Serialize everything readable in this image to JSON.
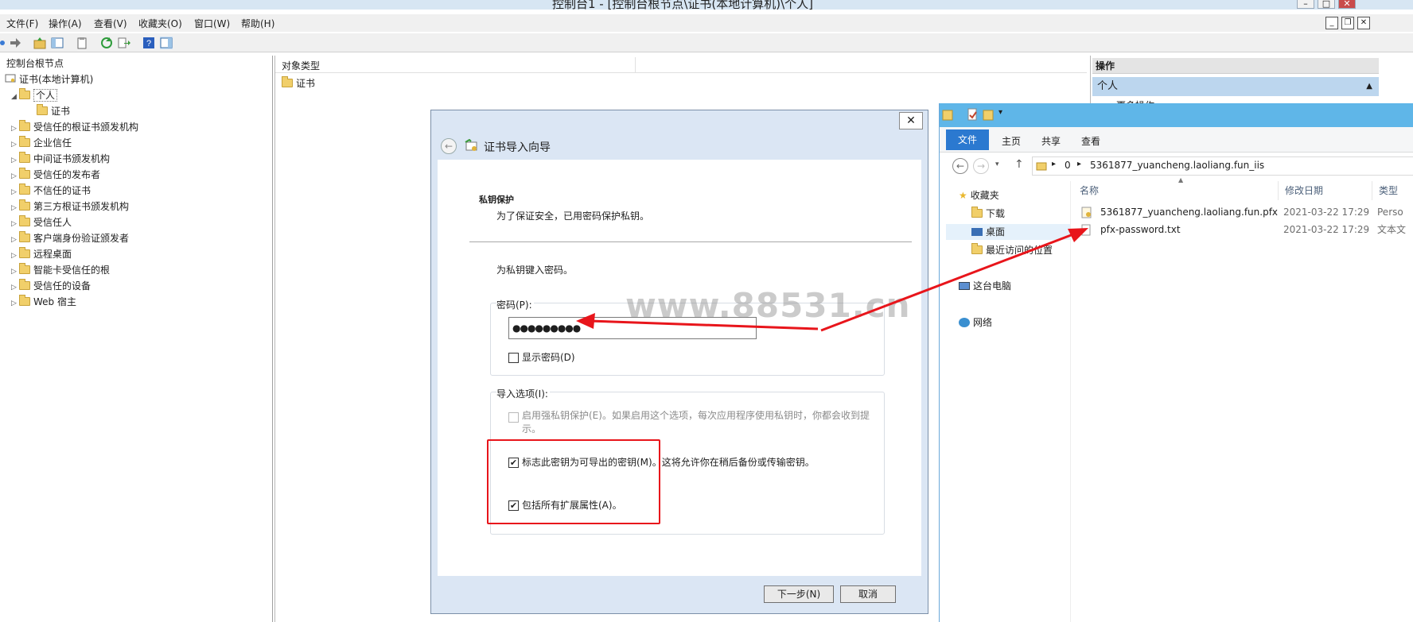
{
  "mmc": {
    "title": "控制台1 - [控制台根节点\\证书(本地计算机)\\个人]",
    "menu": [
      "文件(F)",
      "操作(A)",
      "查看(V)",
      "收藏夹(O)",
      "窗口(W)",
      "帮助(H)"
    ],
    "tree": {
      "root": "控制台根节点",
      "store": "证书(本地计算机)",
      "personal": "个人",
      "personal_child": "证书",
      "items": [
        "受信任的根证书颁发机构",
        "企业信任",
        "中间证书颁发机构",
        "受信任的发布者",
        "不信任的证书",
        "第三方根证书颁发机构",
        "受信任人",
        "客户端身份验证颁发者",
        "远程桌面",
        "智能卡受信任的根",
        "受信任的设备",
        "Web 宿主"
      ]
    },
    "center": {
      "column": "对象类型",
      "row": "证书"
    },
    "actions": {
      "header": "操作",
      "selected": "个人",
      "more": "更多操作"
    }
  },
  "wizard": {
    "title": "证书导入向导",
    "close": "✕",
    "back": "←",
    "section_title": "私钥保护",
    "section_desc": "为了保证安全，已用密码保护私钥。",
    "prompt": "为私钥键入密码。",
    "password_label": "密码(P):",
    "password_value": "●●●●●●●●●",
    "show_password": "显示密码(D)",
    "import_options_label": "导入选项(I):",
    "opt_strong": "启用强私钥保护(E)。如果启用这个选项，每次应用程序使用私钥时，你都会收到提示。",
    "opt_exportable": "标志此密钥为可导出的密钥(M)。这将允许你在稍后备份或传输密钥。",
    "opt_extended": "包括所有扩展属性(A)。",
    "next_button": "下一步(N)",
    "cancel_button": "取消"
  },
  "explorer": {
    "ribbon_tabs": [
      "文件",
      "主页",
      "共享",
      "查看"
    ],
    "address": [
      "0",
      "5361877_yuancheng.laoliang.fun_iis"
    ],
    "nav": [
      "收藏夹",
      "下载",
      "桌面",
      "最近访问的位置",
      "这台电脑",
      "网络"
    ],
    "columns": [
      "名称",
      "修改日期",
      "类型"
    ],
    "files": [
      {
        "name": "5361877_yuancheng.laoliang.fun.pfx",
        "date": "2021-03-22 17:29",
        "type": "Perso"
      },
      {
        "name": "pfx-password.txt",
        "date": "2021-03-22 17:29",
        "type": "文本文"
      }
    ]
  },
  "watermark": "www.88531.cn",
  "colors": {
    "annotation_red": "#e8151b",
    "selection_blue": "#bcd6ee",
    "explorer_title": "#5fb6e8"
  }
}
